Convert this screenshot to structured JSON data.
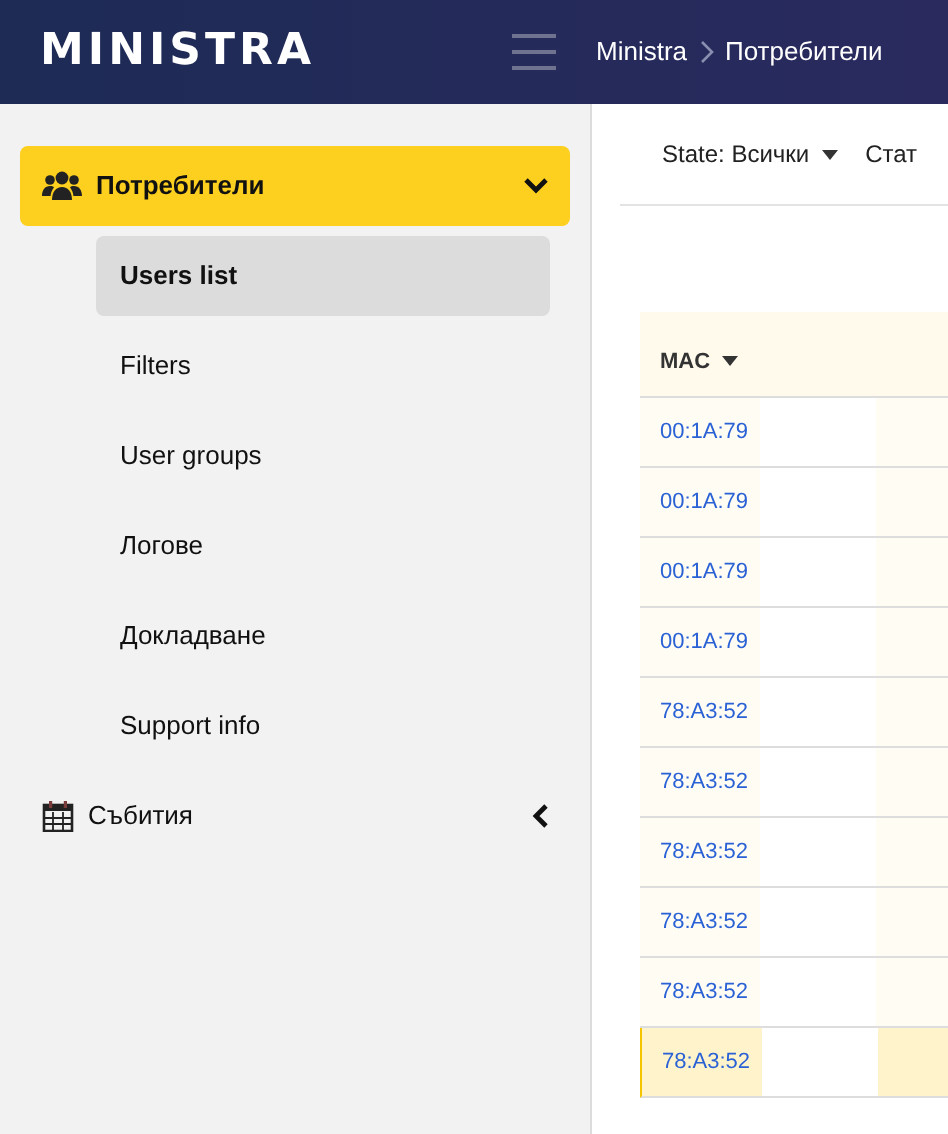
{
  "header": {
    "logo": "MINISTRA",
    "breadcrumb": [
      "Ministra",
      "Потребители"
    ]
  },
  "sidebar": {
    "items": [
      {
        "label": "Потребители",
        "kind": "users",
        "expanded": true,
        "selected": true,
        "children": [
          {
            "label": "Users list",
            "selected": true
          },
          {
            "label": "Filters",
            "selected": false
          },
          {
            "label": "User groups",
            "selected": false
          },
          {
            "label": "Логове",
            "selected": false
          },
          {
            "label": "Докладване",
            "selected": false
          },
          {
            "label": "Support info",
            "selected": false
          }
        ]
      },
      {
        "label": "Събития",
        "kind": "calendar",
        "expanded": false,
        "selected": false
      }
    ]
  },
  "filters": [
    {
      "label": "State: Всички",
      "dropdown": true
    },
    {
      "label": "Стат",
      "dropdown": false
    }
  ],
  "table": {
    "columns": [
      "MAC"
    ],
    "rows": [
      {
        "mac": "00:1A:79",
        "selected": false
      },
      {
        "mac": "00:1A:79",
        "selected": false
      },
      {
        "mac": "00:1A:79",
        "selected": false
      },
      {
        "mac": "00:1A:79",
        "selected": false
      },
      {
        "mac": "78:A3:52",
        "selected": false
      },
      {
        "mac": "78:A3:52",
        "selected": false
      },
      {
        "mac": "78:A3:52",
        "selected": false
      },
      {
        "mac": "78:A3:52",
        "selected": false
      },
      {
        "mac": "78:A3:52",
        "selected": false
      },
      {
        "mac": "78:A3:52",
        "selected": true
      }
    ]
  }
}
